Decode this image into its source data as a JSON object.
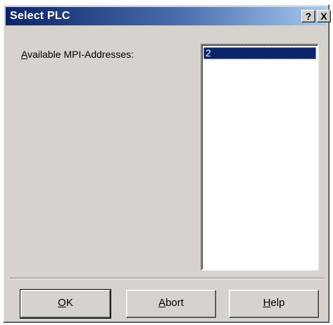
{
  "window": {
    "title": "Select PLC",
    "help_button": "?",
    "close_button": "X"
  },
  "main": {
    "label_prefix": "A",
    "label_rest": "vailable MPI-Addresses:",
    "list_items": [
      "2"
    ]
  },
  "buttons": {
    "ok_mnemonic": "O",
    "ok_rest": "K",
    "abort_mnemonic": "A",
    "abort_rest": "bort",
    "help_mnemonic": "H",
    "help_rest": "elp"
  }
}
